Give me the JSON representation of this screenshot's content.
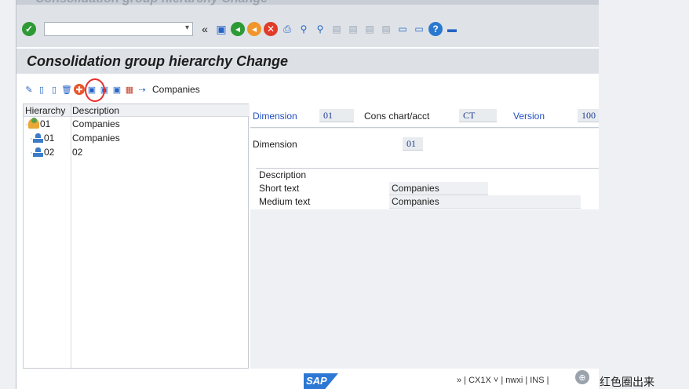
{
  "window": {
    "ghost_title": "Consolidation group hierarchy Change"
  },
  "system_toolbar": {
    "icons": [
      "enter-check-icon",
      "command-field",
      "back-arrows-icon",
      "save-icon",
      "back-green-icon",
      "exit-orange-icon",
      "cancel-red-icon",
      "print-icon",
      "find-icon",
      "find-next-icon",
      "first-page-icon",
      "previous-page-icon",
      "next-page-icon",
      "last-page-icon",
      "new-session-icon",
      "shortcut-icon",
      "help-icon",
      "customize-layout-icon"
    ]
  },
  "app": {
    "title": "Consolidation group hierarchy Change",
    "toolbar_button_label": "Companies"
  },
  "tree": {
    "headers": {
      "hierarchy": "Hierarchy",
      "description": "Description"
    },
    "rows": [
      {
        "node": "01",
        "desc": "Companies",
        "icon": "consolidation-group-icon"
      },
      {
        "node": "01",
        "desc": "Companies",
        "icon": "hierarchy-node-icon"
      },
      {
        "node": "02",
        "desc": "02",
        "icon": "hierarchy-node-icon"
      }
    ]
  },
  "header_fields": {
    "dimension_label": "Dimension",
    "dimension_value": "01",
    "cons_chart_label": "Cons chart/acct",
    "cons_chart_value": "CT",
    "version_label": "Version",
    "version_value": "100"
  },
  "detail": {
    "dimension_label": "Dimension",
    "dimension_value": "01",
    "description_group_label": "Description",
    "short_text_label": "Short text",
    "short_text_value": "Companies",
    "medium_text_label": "Medium text",
    "medium_text_value": "Companies"
  },
  "status_bar": {
    "sap_logo": "SAP",
    "info": "» | CX1X ˅ | nwxi | INS |",
    "caption": "红色圈出来"
  }
}
